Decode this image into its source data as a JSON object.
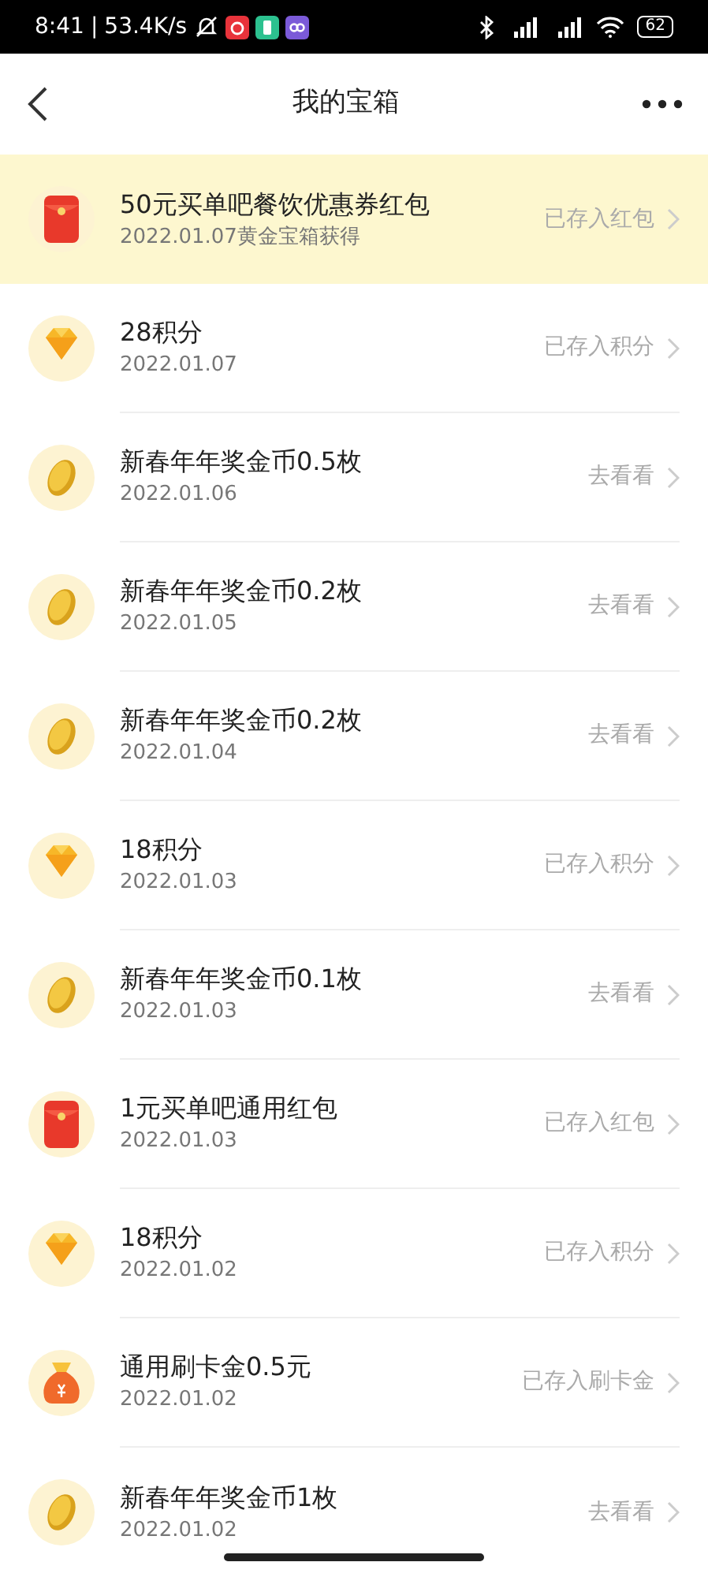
{
  "status_bar": {
    "time": "8:41",
    "separator": "|",
    "speed": "53.4K/s",
    "battery": "62"
  },
  "header": {
    "title": "我的宝箱"
  },
  "items": [
    {
      "kind": "red-packet",
      "title": "50元买单吧餐饮优惠券红包",
      "subtitle": "2022.01.07黄金宝箱获得",
      "action": "已存入红包",
      "highlighted": true
    },
    {
      "kind": "diamond",
      "title": "28积分",
      "subtitle": "2022.01.07",
      "action": "已存入积分",
      "highlighted": false
    },
    {
      "kind": "coin",
      "title": "新春年年奖金币0.5枚",
      "subtitle": "2022.01.06",
      "action": "去看看",
      "highlighted": false
    },
    {
      "kind": "coin",
      "title": "新春年年奖金币0.2枚",
      "subtitle": "2022.01.05",
      "action": "去看看",
      "highlighted": false
    },
    {
      "kind": "coin",
      "title": "新春年年奖金币0.2枚",
      "subtitle": "2022.01.04",
      "action": "去看看",
      "highlighted": false
    },
    {
      "kind": "diamond",
      "title": "18积分",
      "subtitle": "2022.01.03",
      "action": "已存入积分",
      "highlighted": false
    },
    {
      "kind": "coin",
      "title": "新春年年奖金币0.1枚",
      "subtitle": "2022.01.03",
      "action": "去看看",
      "highlighted": false
    },
    {
      "kind": "red-packet",
      "title": "1元买单吧通用红包",
      "subtitle": "2022.01.03",
      "action": "已存入红包",
      "highlighted": false
    },
    {
      "kind": "diamond",
      "title": "18积分",
      "subtitle": "2022.01.02",
      "action": "已存入积分",
      "highlighted": false
    },
    {
      "kind": "money-bag",
      "title": "通用刷卡金0.5元",
      "subtitle": "2022.01.02",
      "action": "已存入刷卡金",
      "highlighted": false
    },
    {
      "kind": "coin",
      "title": "新春年年奖金币1枚",
      "subtitle": "2022.01.02",
      "action": "去看看",
      "highlighted": false
    }
  ]
}
